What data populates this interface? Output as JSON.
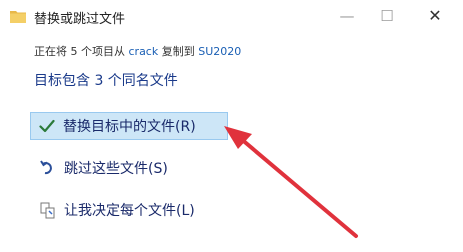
{
  "window": {
    "title": "替换或跳过文件",
    "minimize_glyph": "—",
    "maximize_glyph": "☐",
    "close_glyph": "✕",
    "icon": "folder-icon"
  },
  "status": {
    "prefix": "正在将 5 个项目从 ",
    "source": "crack",
    "middle": " 复制到 ",
    "destination": "SU2020"
  },
  "heading": "目标包含 3 个同名文件",
  "options": [
    {
      "label": "替换目标中的文件(R)",
      "icon": "checkmark-icon",
      "selected": true
    },
    {
      "label": "跳过这些文件(S)",
      "icon": "skip-arrow-icon",
      "selected": false
    },
    {
      "label": "让我决定每个文件(L)",
      "icon": "decide-files-icon",
      "selected": false
    }
  ],
  "colors": {
    "highlight_bg": "#cde6f7",
    "accent_text": "#1a3a8a",
    "annotation_arrow": "#e0323c"
  }
}
